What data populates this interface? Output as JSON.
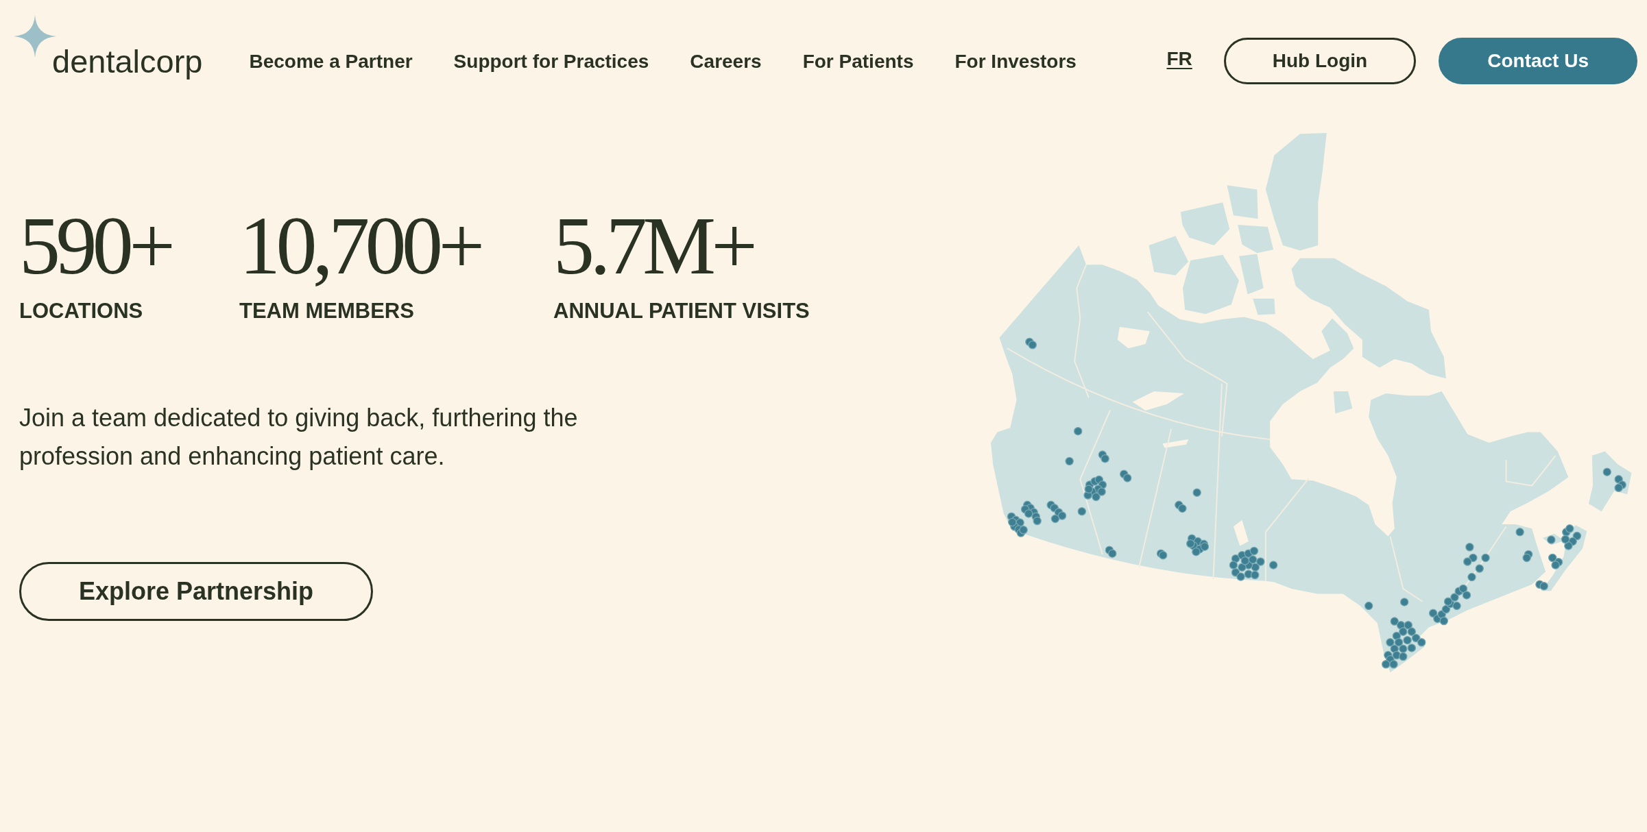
{
  "header": {
    "logo": {
      "text": "dentalcorp"
    },
    "nav": [
      {
        "label": "Become a Partner"
      },
      {
        "label": "Support for Practices"
      },
      {
        "label": "Careers"
      },
      {
        "label": "For Patients"
      },
      {
        "label": "For Investors"
      }
    ],
    "language": {
      "label": "FR"
    },
    "buttons": [
      {
        "label": "Hub Login",
        "kind": "outline"
      },
      {
        "label": "Contact Us",
        "kind": "filled"
      }
    ]
  },
  "stats": [
    {
      "value": "590+",
      "label": "LOCATIONS"
    },
    {
      "value": "10,700+",
      "label": "TEAM MEMBERS"
    },
    {
      "value": "5.7M+",
      "label": "ANNUAL PATIENT VISITS"
    }
  ],
  "intro": {
    "text": "Join a team dedicated to giving back, furthering the profession and enhancing patient care."
  },
  "cta": {
    "label": "Explore Partnership"
  }
}
